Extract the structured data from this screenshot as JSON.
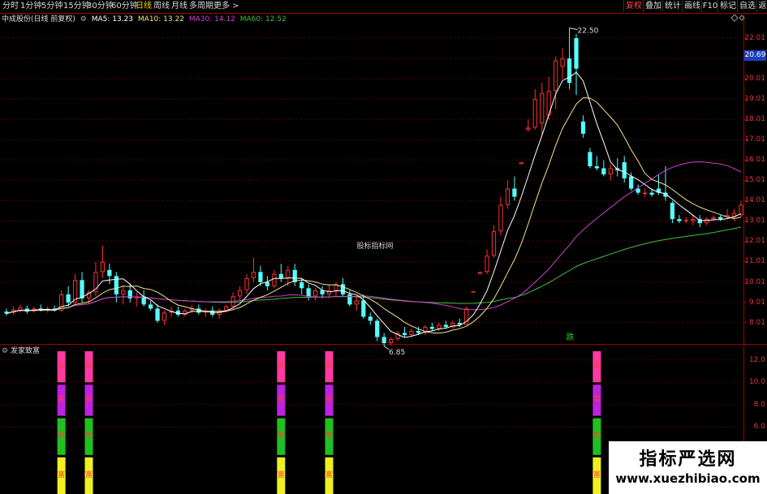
{
  "toolbar": {
    "tabs": [
      {
        "label": "分时",
        "active": false
      },
      {
        "label": "1分钟",
        "active": false
      },
      {
        "label": "5分钟",
        "active": false
      },
      {
        "label": "15分钟",
        "active": false
      },
      {
        "label": "30分钟",
        "active": false
      },
      {
        "label": "60分钟",
        "active": false
      },
      {
        "label": "日线",
        "active": true
      },
      {
        "label": "周线",
        "active": false
      },
      {
        "label": "月线",
        "active": false
      },
      {
        "label": "多周期",
        "active": false
      },
      {
        "label": "更多 >",
        "active": false
      }
    ],
    "right_tabs": [
      {
        "label": "复权",
        "active": true
      },
      {
        "label": "叠加",
        "active": false
      },
      {
        "label": "统计",
        "active": false
      },
      {
        "label": "画线",
        "active": false
      },
      {
        "label": "F10",
        "active": false
      },
      {
        "label": "标记",
        "active": false
      },
      {
        "label": "自选",
        "active": false
      },
      {
        "label": "返",
        "active": false
      }
    ]
  },
  "stock_title": "中成股份(日线 前复权)",
  "ma": {
    "ma5": "MA5: 13.23",
    "ma10": "MA10: 13.22",
    "ma30": "MA30: 14.12",
    "ma60": "MA60: 12.52"
  },
  "center_label": "股标指标网",
  "high_label": "22.50",
  "low_label": "6.85",
  "marker_label": "跌",
  "current_price": "20.69",
  "subchart_title": "发家致富",
  "signal_chars": [
    "发",
    "家",
    "致",
    "富"
  ],
  "price_axis": [
    "22.01",
    "21.01",
    "20.01",
    "19.01",
    "18.01",
    "17.01",
    "16.01",
    "15.01",
    "14.01",
    "13.01",
    "12.01",
    "11.01",
    "10.01",
    "9.01",
    "8.01"
  ],
  "sub_axis": [
    "12.0",
    "10.0",
    "8.0",
    "6.0"
  ],
  "watermark": {
    "cn": "指标严选网",
    "url": "www.xuezhibiao.com"
  },
  "colors": {
    "up": "#ff3030",
    "down": "#54ffff",
    "ma5": "#ffffff",
    "ma10": "#f0e68c",
    "ma30": "#d040d0",
    "ma60": "#40c040",
    "signal_top": "#ff3aa0",
    "signal_mid": "#c020e0",
    "signal_green": "#20c020",
    "signal_yellow": "#f0f020"
  },
  "chart_data": {
    "type": "candlestick",
    "price_range": [
      7.0,
      22.6
    ],
    "candles": [
      {
        "o": 8.55,
        "h": 8.7,
        "l": 8.35,
        "c": 8.45
      },
      {
        "o": 8.5,
        "h": 8.8,
        "l": 8.4,
        "c": 8.65
      },
      {
        "o": 8.6,
        "h": 8.9,
        "l": 8.5,
        "c": 8.75
      },
      {
        "o": 8.7,
        "h": 8.85,
        "l": 8.45,
        "c": 8.55
      },
      {
        "o": 8.55,
        "h": 8.8,
        "l": 8.5,
        "c": 8.7
      },
      {
        "o": 8.7,
        "h": 8.9,
        "l": 8.55,
        "c": 8.6
      },
      {
        "o": 8.6,
        "h": 8.8,
        "l": 8.5,
        "c": 8.7
      },
      {
        "o": 8.7,
        "h": 8.85,
        "l": 8.55,
        "c": 8.6
      },
      {
        "o": 8.6,
        "h": 9.6,
        "l": 8.55,
        "c": 9.4
      },
      {
        "o": 9.4,
        "h": 9.8,
        "l": 8.8,
        "c": 9.0
      },
      {
        "o": 9.0,
        "h": 10.4,
        "l": 8.9,
        "c": 10.1
      },
      {
        "o": 10.1,
        "h": 10.5,
        "l": 9.0,
        "c": 9.2
      },
      {
        "o": 9.2,
        "h": 9.6,
        "l": 8.9,
        "c": 9.5
      },
      {
        "o": 9.5,
        "h": 11.0,
        "l": 9.3,
        "c": 10.5
      },
      {
        "o": 10.5,
        "h": 11.8,
        "l": 10.2,
        "c": 11.0
      },
      {
        "o": 10.6,
        "h": 10.9,
        "l": 9.9,
        "c": 10.3
      },
      {
        "o": 10.3,
        "h": 10.5,
        "l": 9.0,
        "c": 9.4
      },
      {
        "o": 9.4,
        "h": 9.8,
        "l": 8.9,
        "c": 9.6
      },
      {
        "o": 9.6,
        "h": 9.9,
        "l": 9.0,
        "c": 9.2
      },
      {
        "o": 9.2,
        "h": 9.5,
        "l": 8.8,
        "c": 9.3
      },
      {
        "o": 9.3,
        "h": 9.6,
        "l": 8.8,
        "c": 8.9
      },
      {
        "o": 8.9,
        "h": 9.1,
        "l": 8.6,
        "c": 8.7
      },
      {
        "o": 8.7,
        "h": 8.9,
        "l": 8.0,
        "c": 8.1
      },
      {
        "o": 8.1,
        "h": 8.6,
        "l": 7.9,
        "c": 8.5
      },
      {
        "o": 8.5,
        "h": 8.8,
        "l": 8.3,
        "c": 8.6
      },
      {
        "o": 8.6,
        "h": 8.8,
        "l": 8.3,
        "c": 8.4
      },
      {
        "o": 8.4,
        "h": 8.7,
        "l": 8.3,
        "c": 8.6
      },
      {
        "o": 8.6,
        "h": 8.9,
        "l": 8.5,
        "c": 8.7
      },
      {
        "o": 8.7,
        "h": 8.9,
        "l": 8.4,
        "c": 8.5
      },
      {
        "o": 8.5,
        "h": 8.7,
        "l": 8.3,
        "c": 8.6
      },
      {
        "o": 8.6,
        "h": 8.8,
        "l": 8.3,
        "c": 8.4
      },
      {
        "o": 8.4,
        "h": 8.7,
        "l": 8.2,
        "c": 8.6
      },
      {
        "o": 8.6,
        "h": 8.9,
        "l": 8.5,
        "c": 8.8
      },
      {
        "o": 8.8,
        "h": 9.5,
        "l": 8.7,
        "c": 9.3
      },
      {
        "o": 9.3,
        "h": 9.8,
        "l": 9.1,
        "c": 9.6
      },
      {
        "o": 9.6,
        "h": 10.4,
        "l": 9.4,
        "c": 10.2
      },
      {
        "o": 10.2,
        "h": 11.2,
        "l": 10.0,
        "c": 10.5
      },
      {
        "o": 10.5,
        "h": 10.8,
        "l": 9.8,
        "c": 10.0
      },
      {
        "o": 10.0,
        "h": 10.3,
        "l": 9.6,
        "c": 9.8
      },
      {
        "o": 9.8,
        "h": 10.6,
        "l": 9.7,
        "c": 10.4
      },
      {
        "o": 10.4,
        "h": 10.9,
        "l": 10.0,
        "c": 10.2
      },
      {
        "o": 10.2,
        "h": 10.8,
        "l": 9.8,
        "c": 10.6
      },
      {
        "o": 10.6,
        "h": 10.9,
        "l": 9.8,
        "c": 10.0
      },
      {
        "o": 10.0,
        "h": 10.2,
        "l": 9.4,
        "c": 9.7
      },
      {
        "o": 9.7,
        "h": 9.9,
        "l": 9.1,
        "c": 9.3
      },
      {
        "o": 9.3,
        "h": 9.7,
        "l": 9.1,
        "c": 9.6
      },
      {
        "o": 9.6,
        "h": 9.8,
        "l": 9.2,
        "c": 9.4
      },
      {
        "o": 9.4,
        "h": 9.9,
        "l": 9.2,
        "c": 9.6
      },
      {
        "o": 9.6,
        "h": 10.0,
        "l": 9.3,
        "c": 9.9
      },
      {
        "o": 9.9,
        "h": 10.2,
        "l": 9.3,
        "c": 9.4
      },
      {
        "o": 9.4,
        "h": 9.6,
        "l": 8.8,
        "c": 8.9
      },
      {
        "o": 8.9,
        "h": 9.3,
        "l": 8.6,
        "c": 9.1
      },
      {
        "o": 9.1,
        "h": 9.4,
        "l": 8.2,
        "c": 8.3
      },
      {
        "o": 8.3,
        "h": 8.5,
        "l": 7.9,
        "c": 8.1
      },
      {
        "o": 8.1,
        "h": 8.2,
        "l": 7.1,
        "c": 7.3
      },
      {
        "o": 7.3,
        "h": 7.5,
        "l": 6.85,
        "c": 7.0
      },
      {
        "o": 7.0,
        "h": 7.3,
        "l": 6.9,
        "c": 7.2
      },
      {
        "o": 7.2,
        "h": 7.6,
        "l": 7.1,
        "c": 7.5
      },
      {
        "o": 7.5,
        "h": 7.8,
        "l": 7.3,
        "c": 7.4
      },
      {
        "o": 7.4,
        "h": 7.7,
        "l": 7.3,
        "c": 7.6
      },
      {
        "o": 7.6,
        "h": 7.8,
        "l": 7.4,
        "c": 7.5
      },
      {
        "o": 7.5,
        "h": 7.9,
        "l": 7.4,
        "c": 7.8
      },
      {
        "o": 7.8,
        "h": 8.0,
        "l": 7.6,
        "c": 7.7
      },
      {
        "o": 7.7,
        "h": 8.0,
        "l": 7.6,
        "c": 7.9
      },
      {
        "o": 7.9,
        "h": 8.1,
        "l": 7.7,
        "c": 7.8
      },
      {
        "o": 7.8,
        "h": 8.1,
        "l": 7.7,
        "c": 8.0
      },
      {
        "o": 8.0,
        "h": 8.2,
        "l": 7.8,
        "c": 7.9
      },
      {
        "o": 7.9,
        "h": 8.8,
        "l": 7.9,
        "c": 8.7
      },
      {
        "o": 9.5,
        "h": 9.55,
        "l": 9.5,
        "c": 9.55
      },
      {
        "o": 10.4,
        "h": 10.5,
        "l": 10.4,
        "c": 10.5
      },
      {
        "o": 10.5,
        "h": 11.6,
        "l": 10.4,
        "c": 11.3
      },
      {
        "o": 11.3,
        "h": 12.8,
        "l": 11.2,
        "c": 12.5
      },
      {
        "o": 12.5,
        "h": 14.2,
        "l": 12.3,
        "c": 13.8
      },
      {
        "o": 13.8,
        "h": 15.0,
        "l": 13.6,
        "c": 14.6
      },
      {
        "o": 14.6,
        "h": 15.2,
        "l": 14.0,
        "c": 14.2
      },
      {
        "o": 15.8,
        "h": 15.9,
        "l": 15.8,
        "c": 15.9
      },
      {
        "o": 17.5,
        "h": 18.0,
        "l": 17.4,
        "c": 17.6
      },
      {
        "o": 17.6,
        "h": 19.5,
        "l": 17.5,
        "c": 19.0
      },
      {
        "o": 17.8,
        "h": 19.8,
        "l": 17.2,
        "c": 19.3
      },
      {
        "o": 18.2,
        "h": 20.1,
        "l": 18.0,
        "c": 19.4
      },
      {
        "o": 19.4,
        "h": 21.1,
        "l": 18.5,
        "c": 20.9
      },
      {
        "o": 20.6,
        "h": 21.5,
        "l": 20.0,
        "c": 21.0
      },
      {
        "o": 21.0,
        "h": 22.5,
        "l": 19.5,
        "c": 19.8
      },
      {
        "o": 22.0,
        "h": 22.2,
        "l": 19.2,
        "c": 20.5
      },
      {
        "o": 17.9,
        "h": 18.2,
        "l": 17.1,
        "c": 17.3
      },
      {
        "o": 16.4,
        "h": 16.6,
        "l": 15.6,
        "c": 15.7
      },
      {
        "o": 15.7,
        "h": 16.2,
        "l": 15.5,
        "c": 15.6
      },
      {
        "o": 15.6,
        "h": 16.0,
        "l": 15.2,
        "c": 15.3
      },
      {
        "o": 15.3,
        "h": 15.8,
        "l": 15.0,
        "c": 15.6
      },
      {
        "o": 15.6,
        "h": 16.1,
        "l": 15.2,
        "c": 15.5
      },
      {
        "o": 15.9,
        "h": 16.2,
        "l": 14.9,
        "c": 15.1
      },
      {
        "o": 15.2,
        "h": 15.4,
        "l": 14.5,
        "c": 14.6
      },
      {
        "o": 14.6,
        "h": 14.8,
        "l": 14.3,
        "c": 14.4
      },
      {
        "o": 14.4,
        "h": 14.6,
        "l": 14.2,
        "c": 14.4
      },
      {
        "o": 14.4,
        "h": 14.6,
        "l": 14.2,
        "c": 14.3
      },
      {
        "o": 14.6,
        "h": 15.3,
        "l": 14.3,
        "c": 14.4
      },
      {
        "o": 14.4,
        "h": 15.7,
        "l": 14.0,
        "c": 14.2
      },
      {
        "o": 13.9,
        "h": 14.0,
        "l": 12.9,
        "c": 13.1
      },
      {
        "o": 13.1,
        "h": 13.3,
        "l": 12.9,
        "c": 13.0
      },
      {
        "o": 13.0,
        "h": 13.2,
        "l": 12.9,
        "c": 13.05
      },
      {
        "o": 13.0,
        "h": 13.3,
        "l": 12.8,
        "c": 13.1
      },
      {
        "o": 13.1,
        "h": 13.3,
        "l": 12.7,
        "c": 12.9
      },
      {
        "o": 12.9,
        "h": 13.2,
        "l": 12.8,
        "c": 13.1
      },
      {
        "o": 13.1,
        "h": 13.3,
        "l": 13.0,
        "c": 13.2
      },
      {
        "o": 13.2,
        "h": 13.3,
        "l": 13.0,
        "c": 13.1
      },
      {
        "o": 13.2,
        "h": 13.6,
        "l": 13.1,
        "c": 13.3
      },
      {
        "o": 13.2,
        "h": 13.6,
        "l": 13.0,
        "c": 13.4
      },
      {
        "o": 13.3,
        "h": 14.0,
        "l": 13.2,
        "c": 13.8
      }
    ],
    "signal_candle_indices": [
      8,
      12,
      40,
      47,
      86
    ]
  }
}
